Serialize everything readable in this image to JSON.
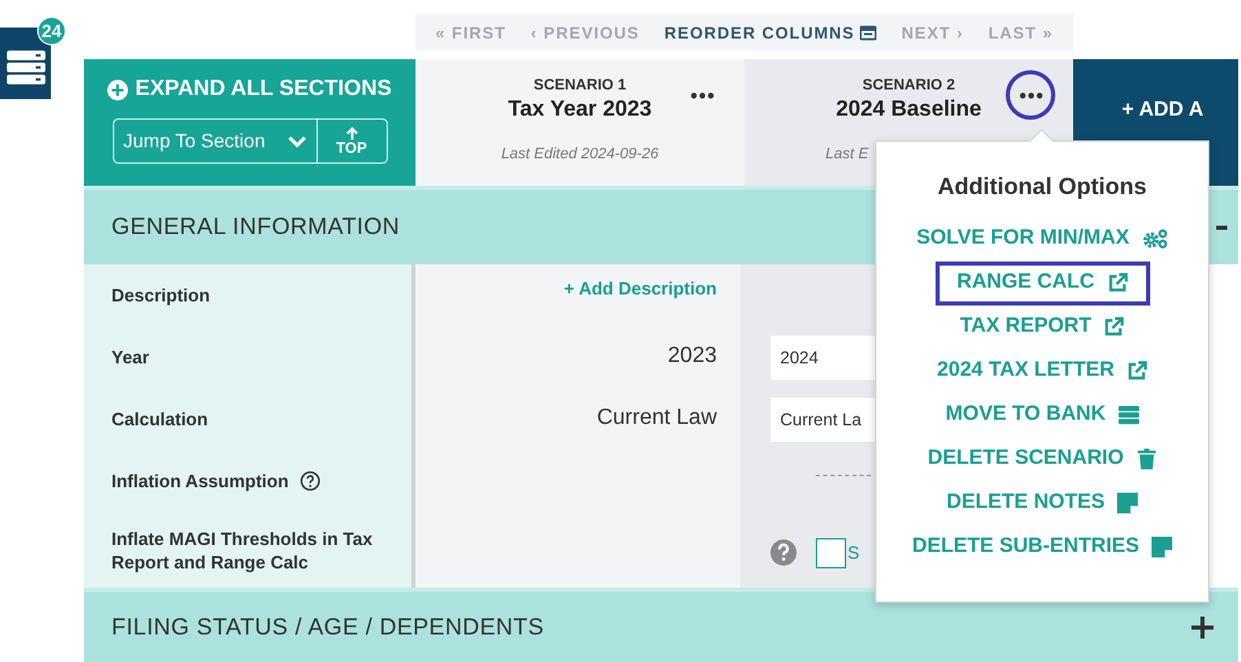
{
  "sidebar_button": {
    "badge": "24"
  },
  "pager": [
    {
      "label": "« FIRST",
      "disabled": true,
      "icon": false
    },
    {
      "label": "‹ PREVIOUS",
      "disabled": true,
      "icon": false
    },
    {
      "label": "REORDER COLUMNS",
      "disabled": false,
      "icon": true
    },
    {
      "label": "NEXT ›",
      "disabled": true,
      "icon": false
    },
    {
      "label": "LAST »",
      "disabled": true,
      "icon": false
    }
  ],
  "controls": {
    "expand_all": "EXPAND ALL SECTIONS",
    "jump_select": "Jump To Section",
    "top_button": "TOP"
  },
  "scenarios": [
    {
      "number": "SCENARIO 1",
      "title": "Tax Year 2023",
      "last_edited": "Last Edited 2024-09-26",
      "menu_circled": false
    },
    {
      "number": "SCENARIO 2",
      "title": "2024 Baseline",
      "last_edited": "Last E",
      "menu_circled": true
    }
  ],
  "add_column": "+ ADD A",
  "sections": [
    {
      "title": "GENERAL INFORMATION",
      "expanded": true
    },
    {
      "title": "FILING STATUS / AGE / DEPENDENTS",
      "expanded": false
    }
  ],
  "rows": [
    {
      "label": "Description",
      "help": false,
      "scenario_1": {
        "kind": "link",
        "text": "+ Add Description"
      }
    },
    {
      "label": "Year",
      "help": false,
      "scenario_1": {
        "kind": "text",
        "text": "2023"
      },
      "scenario_2": {
        "kind": "input",
        "value": "2024"
      }
    },
    {
      "label": "Calculation",
      "help": false,
      "scenario_1": {
        "kind": "text",
        "text": "Current Law"
      },
      "scenario_2": {
        "kind": "input",
        "value": "Current La"
      }
    },
    {
      "label": "Inflation Assumption",
      "help": true,
      "scenario_2": {
        "kind": "dashed"
      }
    },
    {
      "label": "Inflate MAGI Thresholds in Tax Report and Range Calc",
      "help": false,
      "scenario_2": {
        "kind": "checkbox",
        "checked": false,
        "label": "S"
      }
    }
  ],
  "popup": {
    "title": "Additional Options",
    "items": [
      {
        "label": "SOLVE FOR MIN/MAX",
        "kind": "gears",
        "highlighted": false
      },
      {
        "label": "RANGE CALC",
        "kind": "external",
        "highlighted": true
      },
      {
        "label": "TAX REPORT",
        "kind": "external",
        "highlighted": false
      },
      {
        "label": "2024 TAX LETTER",
        "kind": "external",
        "highlighted": false
      },
      {
        "label": "MOVE TO BANK",
        "kind": "stack",
        "highlighted": false
      },
      {
        "label": "DELETE SCENARIO",
        "kind": "trash",
        "highlighted": false
      },
      {
        "label": "DELETE NOTES",
        "kind": "note",
        "highlighted": false
      },
      {
        "label": "DELETE SUB-ENTRIES",
        "kind": "note",
        "highlighted": false
      }
    ]
  }
}
